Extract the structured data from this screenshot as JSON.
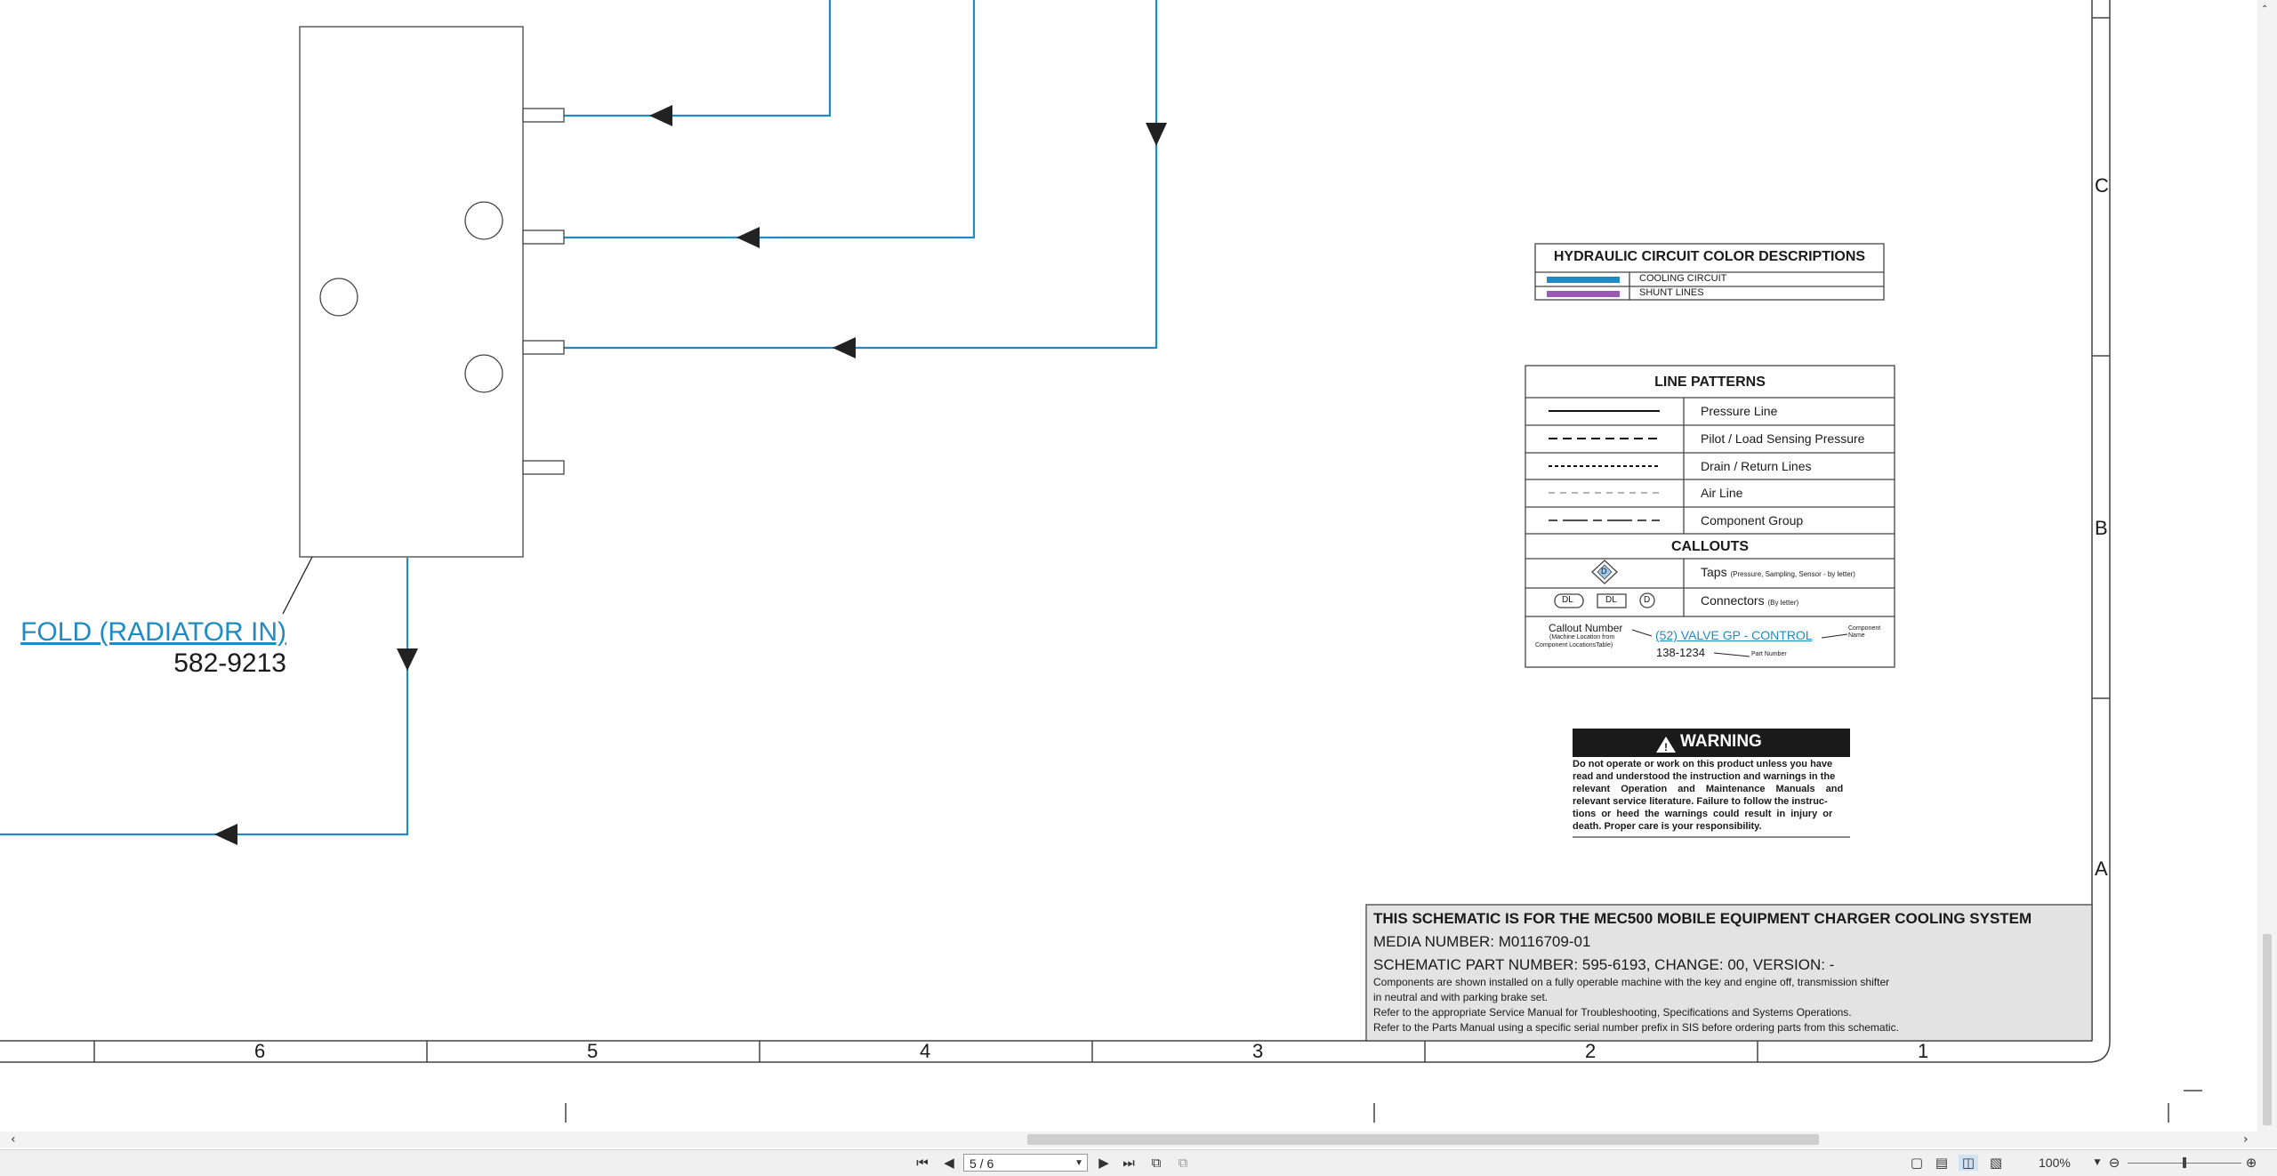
{
  "schematic": {
    "component_callout": "FOLD (RADIATOR IN)",
    "component_part_number": "582-9213",
    "zone_letters": [
      "C",
      "B",
      "A"
    ],
    "column_numbers": [
      "6",
      "5",
      "4",
      "3",
      "2",
      "1"
    ]
  },
  "color_legend": {
    "title": "HYDRAULIC CIRCUIT COLOR DESCRIPTIONS",
    "items": [
      {
        "label": "COOLING CIRCUIT",
        "color": "#1f8ac4"
      },
      {
        "label": "SHUNT LINES",
        "color": "#9b59b6"
      }
    ]
  },
  "line_patterns": {
    "title": "LINE PATTERNS",
    "items": [
      "Pressure Line",
      "Pilot / Load Sensing Pressure",
      "Drain / Return Lines",
      "Air Line",
      "Component Group"
    ],
    "callouts_title": "CALLOUTS",
    "taps_label": "Taps",
    "taps_note": "(Pressure, Sampling, Sensor - by letter)",
    "tap_letter": "D",
    "connectors_label": "Connectors",
    "connectors_note": "(By letter)",
    "connector_tags": [
      "DL",
      "DL",
      "D"
    ],
    "callout_number_label": "Callout Number",
    "callout_number_note1": "(Machine Location from",
    "callout_number_note2": "Component LocationsTable)",
    "example_callout": "(52) VALVE GP - CONTROL",
    "component_name_label1": "Component",
    "component_name_label2": "Name",
    "example_part_number": "138-1234",
    "part_number_label": "Part Number"
  },
  "warning": {
    "title": "WARNING",
    "lines": [
      "Do not operate or work on this product unless you have",
      "read and understood the instruction and warnings in the",
      "relevant Operation and Maintenance Manuals and",
      "relevant service literature. Failure to follow the instruc-",
      "tions or heed the warnings could result in injury or",
      "death. Proper care is your responsibility."
    ]
  },
  "title_block": {
    "heading": "THIS SCHEMATIC IS FOR THE MEC500 MOBILE EQUIPMENT CHARGER COOLING SYSTEM",
    "media_number": "MEDIA NUMBER: M0116709-01",
    "part_number": "SCHEMATIC PART NUMBER: 595-6193, CHANGE: 00, VERSION: -",
    "notes": [
      "Components are shown installed on a fully operable machine with the key and engine off, transmission shifter",
      "in neutral and with parking brake set.",
      "Refer to the appropriate Service Manual for Troubleshooting, Specifications and Systems Operations.",
      "Refer to the Parts Manual using a specific serial number prefix in SIS before ordering parts from this schematic."
    ]
  },
  "viewer": {
    "page_indicator": "5 / 6",
    "zoom_level": "100%",
    "icons": [
      "first-page-icon",
      "previous-page-icon",
      "next-page-icon",
      "last-page-icon",
      "single-page-view-icon",
      "continuous-view-icon",
      "two-page-view-icon",
      "book-view-icon",
      "zoom-out-icon",
      "zoom-in-icon"
    ]
  },
  "colors": {
    "cooling_line": "#1f8ac4",
    "shunt_line": "#9b59b6",
    "title_block_bg": "#e3e3e3",
    "warning_header_bg": "#1a1a1a"
  }
}
